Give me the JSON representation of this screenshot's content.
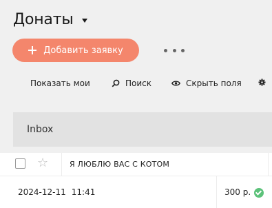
{
  "header": {
    "title": "Донаты"
  },
  "actions": {
    "add_label": "Добавить заявку"
  },
  "toolbar": {
    "show_mine": "Показать мои",
    "search": "Поиск",
    "hide_fields": "Скрыть поля"
  },
  "folder": {
    "name": "Inbox"
  },
  "items": [
    {
      "subject": "Я ЛЮБЛЮ ВАС С КОТОМ",
      "date": "2024-12-11",
      "time": "11:41",
      "amount": "300 р.",
      "status": "paid",
      "status_color": "#5cc27a"
    }
  ],
  "colors": {
    "accent": "#f4866c",
    "background": "#f0f0f0",
    "inbox_bg": "#e2e2e2"
  },
  "icons": [
    "caret-down-icon",
    "plus-icon",
    "more-dots-icon",
    "search-icon",
    "eye-icon",
    "gear-icon",
    "star-icon",
    "check-circle-icon"
  ]
}
